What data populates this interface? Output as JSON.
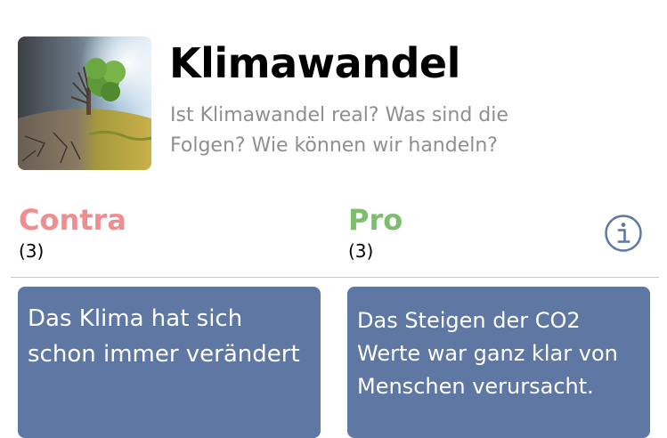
{
  "topic": {
    "title": "Klimawandel",
    "subtitle": "Ist Klimawandel real? Was sind die Folgen? Wie können wir handeln?",
    "image_icon": "tree-climate-split-image"
  },
  "columns": {
    "contra": {
      "label": "Contra",
      "count": "(3)",
      "color": "#ee8e8e"
    },
    "pro": {
      "label": "Pro",
      "count": "(3)",
      "color": "#7dbd6e"
    }
  },
  "info_icon": "info-circle-icon",
  "cards": {
    "contra": [
      {
        "text": "Das Klima hat sich schon immer verändert"
      }
    ],
    "pro": [
      {
        "text": "Das Steigen der CO2 Werte war ganz klar von Menschen verursacht."
      }
    ]
  },
  "colors": {
    "card_background": "#5f77a3",
    "info_icon": "#5f77a3",
    "subtitle": "#8e8e93"
  }
}
